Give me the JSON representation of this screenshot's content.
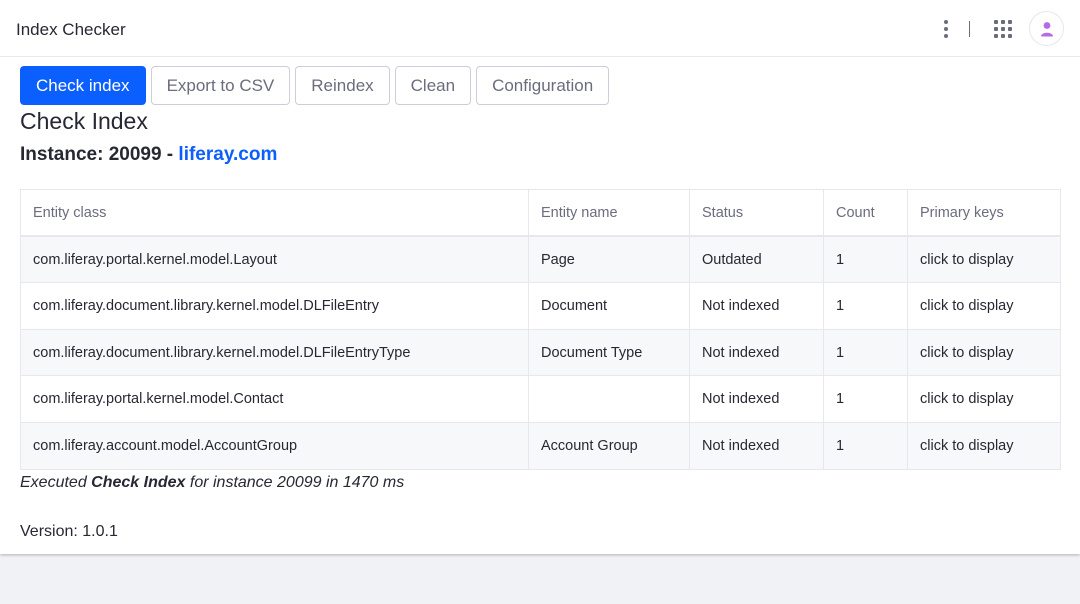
{
  "header": {
    "title": "Index Checker",
    "icons": [
      "kebab-menu-icon",
      "apps-grid-icon",
      "user-avatar-icon"
    ]
  },
  "toolbar": {
    "check_index": "Check index",
    "export_csv": "Export to CSV",
    "reindex": "Reindex",
    "clean": "Clean",
    "configuration": "Configuration"
  },
  "page": {
    "title": "Check Index",
    "instance_prefix": "Instance: 20099 - ",
    "instance_link": "liferay.com"
  },
  "table": {
    "columns": [
      "Entity class",
      "Entity name",
      "Status",
      "Count",
      "Primary keys"
    ],
    "rows": [
      [
        "com.liferay.portal.kernel.model.Layout",
        "Page",
        "Outdated",
        "1",
        "click to display"
      ],
      [
        "com.liferay.document.library.kernel.model.DLFileEntry",
        "Document",
        "Not indexed",
        "1",
        "click to display"
      ],
      [
        "com.liferay.document.library.kernel.model.DLFileEntryType",
        "Document Type",
        "Not indexed",
        "1",
        "click to display"
      ],
      [
        "com.liferay.portal.kernel.model.Contact",
        "",
        "Not indexed",
        "1",
        "click to display"
      ],
      [
        "com.liferay.account.model.AccountGroup",
        "Account Group",
        "Not indexed",
        "1",
        "click to display"
      ]
    ]
  },
  "footer": {
    "exec_prefix": "Executed ",
    "exec_action": "Check Index",
    "exec_suffix": " for instance 20099 in 1470 ms",
    "version": "Version: 1.0.1"
  },
  "colors": {
    "primary": "#0b5fff",
    "text": "#272833",
    "muted": "#6b6c7e",
    "border": "#e7e7ed",
    "stripe": "#f7f8f9",
    "avatar": "#b56be8"
  }
}
